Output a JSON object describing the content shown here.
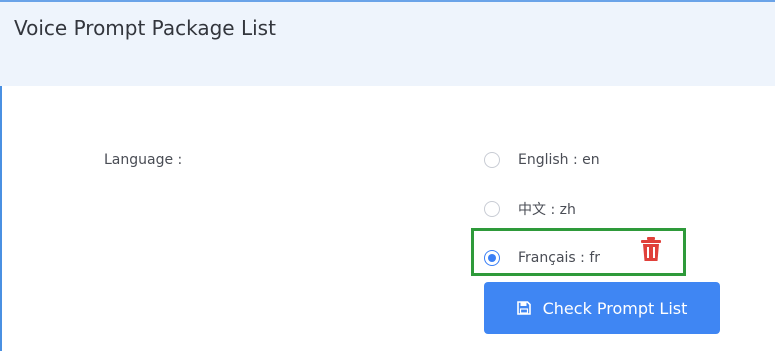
{
  "panel": {
    "title": "Voice Prompt Package List"
  },
  "form": {
    "language_label": "Language :",
    "options": [
      {
        "label": "English : en",
        "selected": false
      },
      {
        "label": "中文 : zh",
        "selected": false
      },
      {
        "label": "Français : fr",
        "selected": true
      }
    ],
    "check_button_label": "Check Prompt List"
  },
  "colors": {
    "accent": "#3f86f3",
    "highlight_border": "#2e9a3a",
    "delete_icon": "#e0403a"
  },
  "icons": {
    "delete": "trash-icon",
    "button": "save-icon"
  }
}
